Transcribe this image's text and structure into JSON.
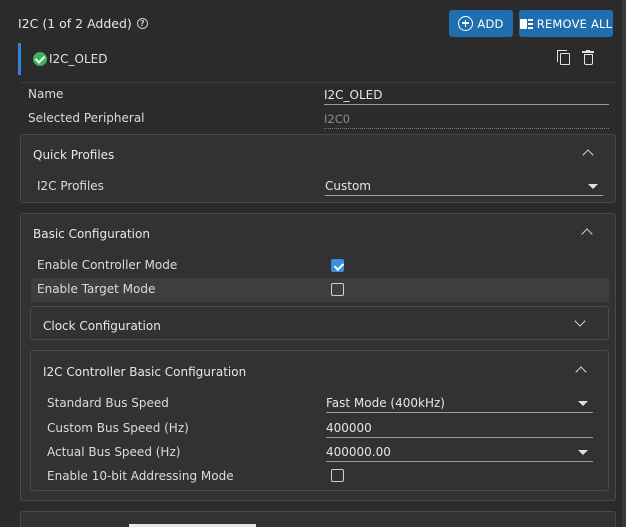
{
  "header": {
    "title": "I2C (1 of 2 Added)",
    "help_icon": "?",
    "add_label": "ADD",
    "remove_all_label": "REMOVE ALL"
  },
  "instance": {
    "name": "I2C_OLED"
  },
  "fields": {
    "name_label": "Name",
    "name_value": "I2C_OLED",
    "peripheral_label": "Selected Peripheral",
    "peripheral_value": "I2C0"
  },
  "quick_profiles": {
    "title": "Quick Profiles",
    "profiles_label": "I2C Profiles",
    "profiles_value": "Custom"
  },
  "basic_config": {
    "title": "Basic Configuration",
    "controller_mode_label": "Enable Controller Mode",
    "controller_mode_checked": true,
    "target_mode_label": "Enable Target Mode",
    "target_mode_checked": false,
    "clock_config_title": "Clock Configuration",
    "controller_basic": {
      "title": "I2C Controller Basic Configuration",
      "std_bus_speed_label": "Standard Bus Speed",
      "std_bus_speed_value": "Fast Mode (400kHz)",
      "custom_bus_speed_label": "Custom Bus Speed (Hz)",
      "custom_bus_speed_value": "400000",
      "actual_bus_speed_label": "Actual Bus Speed (Hz)",
      "actual_bus_speed_value": "400000.00",
      "ten_bit_label": "Enable 10-bit Addressing Mode",
      "ten_bit_checked": false
    }
  },
  "colors": {
    "background": "#2b2b2b",
    "panel": "#323232",
    "accent": "#1f6fb0",
    "success": "#3cb45a",
    "checkbox": "#3b8ee0"
  }
}
